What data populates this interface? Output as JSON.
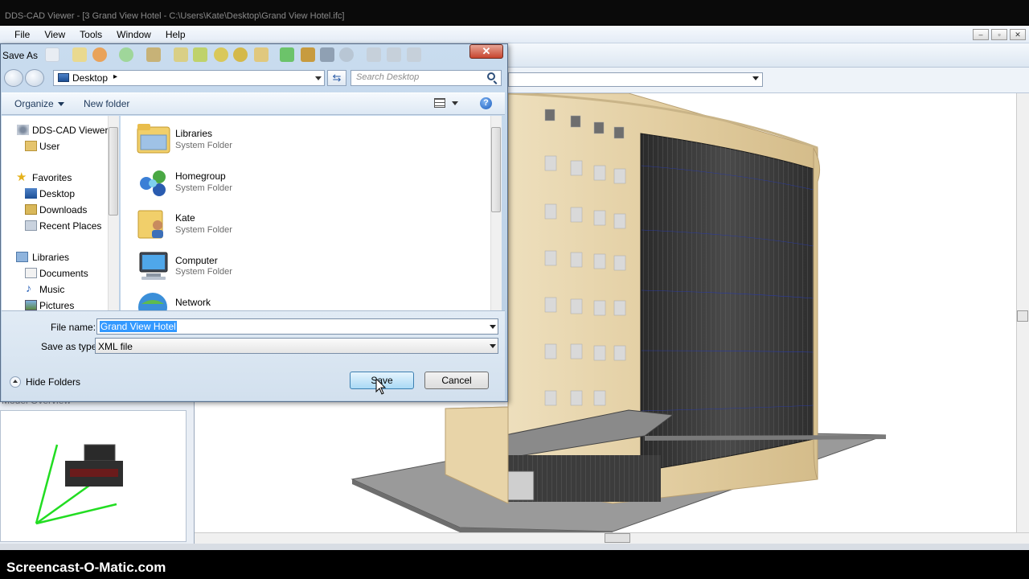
{
  "app": {
    "title": "DDS-CAD Viewer - [3 Grand View Hotel - C:\\Users\\Kate\\Desktop\\Grand View Hotel.ifc]",
    "menu": [
      "File",
      "View",
      "Tools",
      "Window",
      "Help"
    ],
    "window_controls": [
      "–",
      "▫",
      "✕"
    ],
    "model_overview_label": "Model Overview"
  },
  "dialog": {
    "title": "Save As",
    "close": "✕",
    "address": "Desktop",
    "address_chevron": "▸",
    "search_placeholder": "Search Desktop",
    "organize": "Organize",
    "new_folder": "New folder",
    "help": "?",
    "nav": {
      "items": [
        {
          "label": "DDS-CAD Viewer",
          "icon": "app-icon"
        },
        {
          "label": "User",
          "icon": "user-folder-icon"
        },
        {
          "label": "Favorites",
          "icon": "star-icon"
        },
        {
          "label": "Desktop",
          "icon": "desktop-icon"
        },
        {
          "label": "Downloads",
          "icon": "downloads-icon"
        },
        {
          "label": "Recent Places",
          "icon": "recent-places-icon"
        },
        {
          "label": "Libraries",
          "icon": "libraries-icon"
        },
        {
          "label": "Documents",
          "icon": "documents-icon"
        },
        {
          "label": "Music",
          "icon": "music-icon"
        },
        {
          "label": "Pictures",
          "icon": "pictures-icon"
        }
      ]
    },
    "files": [
      {
        "name": "Libraries",
        "type": "System Folder",
        "icon": "libraries-folder-icon"
      },
      {
        "name": "Homegroup",
        "type": "System Folder",
        "icon": "homegroup-icon"
      },
      {
        "name": "Kate",
        "type": "System Folder",
        "icon": "user-folder-icon"
      },
      {
        "name": "Computer",
        "type": "System Folder",
        "icon": "computer-icon"
      },
      {
        "name": "Network",
        "type": "",
        "icon": "network-icon"
      }
    ],
    "file_name_label": "File name:",
    "file_name_value": "Grand View Hotel",
    "save_type_label": "Save as type:",
    "save_type_value": "XML file",
    "hide_folders": "Hide Folders",
    "save": "Save",
    "cancel": "Cancel"
  },
  "watermark": "Screencast-O-Matic.com",
  "colors": {
    "building_facade": "#e6d2a6",
    "glass_curtain": "#3a3a3a",
    "selection": "#3399ff"
  }
}
